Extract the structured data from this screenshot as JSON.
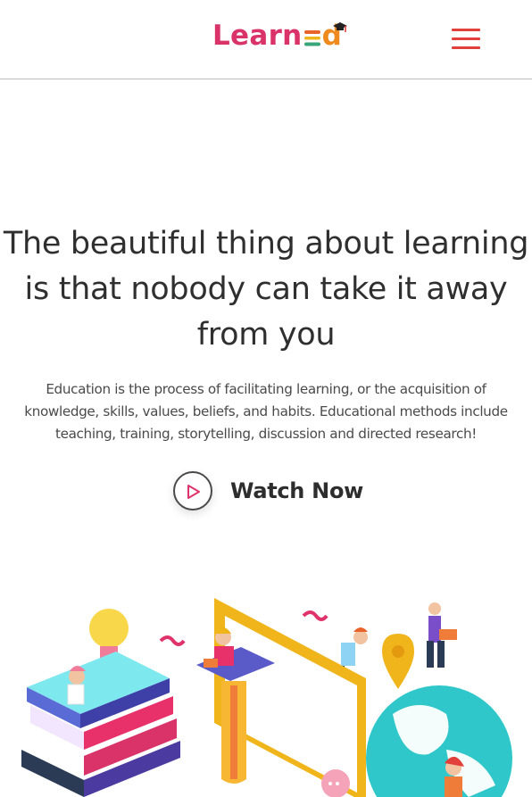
{
  "header": {
    "logo": {
      "part1": "Learn",
      "part2": "d"
    },
    "menu_icon": "hamburger-menu-icon"
  },
  "hero": {
    "headline_line1": "The beautiful thing about learning",
    "headline_line2": "is that nobody can take it away",
    "headline_line3": "from you",
    "desc_line1": "Education is the process of facilitating learning, or the acquisition of",
    "desc_line2": "knowledge, skills, values, beliefs, and habits. Educational methods include",
    "desc_line3": "teaching, training, storytelling, discussion and directed research!",
    "watch_label": "Watch Now",
    "play_icon": "play-icon"
  },
  "colors": {
    "brand_pink": "#d9336a",
    "brand_orange": "#e8642c",
    "menu_red": "#e2403a",
    "text_dark": "#2f2f2f"
  }
}
